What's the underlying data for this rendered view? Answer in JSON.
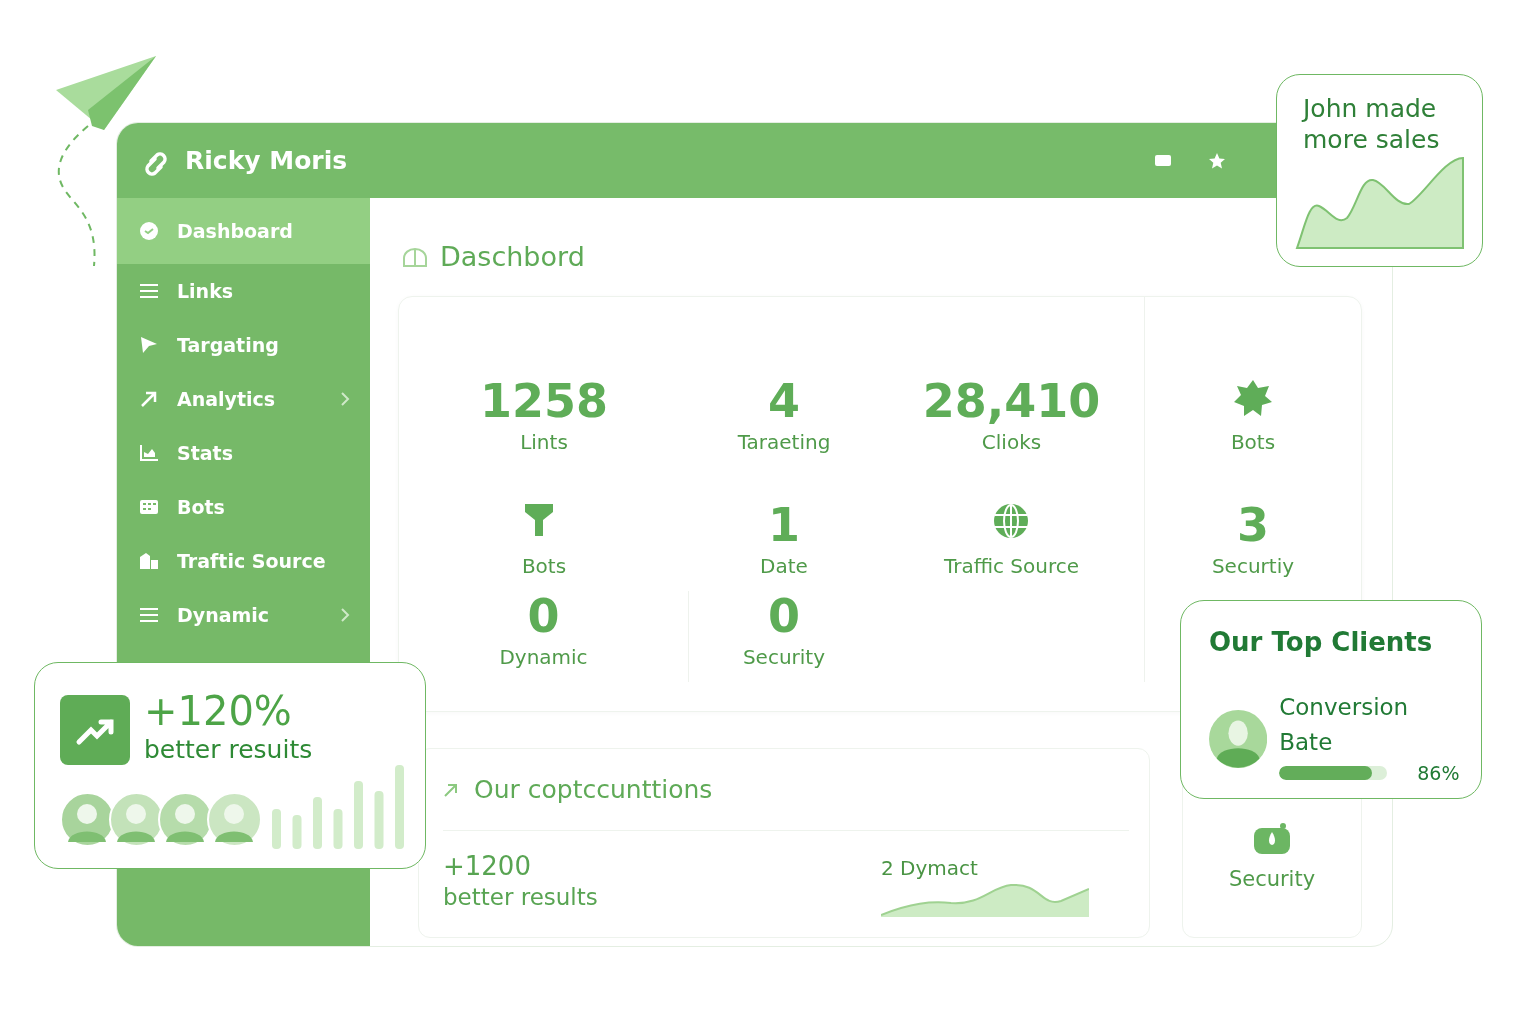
{
  "header": {
    "title": "Ricky Moris"
  },
  "sidebar": {
    "items": [
      {
        "label": "Dashboard",
        "selected": true,
        "expandable": false
      },
      {
        "label": "Links",
        "selected": false,
        "expandable": false
      },
      {
        "label": "Targating",
        "selected": false,
        "expandable": false
      },
      {
        "label": "Analytics",
        "selected": false,
        "expandable": true
      },
      {
        "label": "Stats",
        "selected": false,
        "expandable": false
      },
      {
        "label": "Bots",
        "selected": false,
        "expandable": false
      },
      {
        "label": "Traftic Source",
        "selected": false,
        "expandable": false
      },
      {
        "label": "Dynamic",
        "selected": false,
        "expandable": true
      }
    ]
  },
  "page_title": "Daschbord",
  "stats": [
    {
      "kind": "number",
      "value": "1258",
      "label": "Lints"
    },
    {
      "kind": "number",
      "value": "4",
      "label": "Taraeting"
    },
    {
      "kind": "number",
      "value": "28,410",
      "label": "Clioks"
    },
    {
      "kind": "icon",
      "label": "Bots"
    },
    {
      "kind": "icon",
      "label": "Bots"
    },
    {
      "kind": "number",
      "value": "1",
      "label": "Date"
    },
    {
      "kind": "icon",
      "label": "Traffic Source"
    },
    {
      "kind": "number",
      "value": "3",
      "label": "Securtiy"
    },
    {
      "kind": "number",
      "value": "0",
      "label": "Dynamic"
    },
    {
      "kind": "number",
      "value": "0",
      "label": "Security"
    }
  ],
  "conversions_card": {
    "title": "Our coptccunttions",
    "value": "+1200",
    "caption": "better results",
    "trend_label": "2 Dymact"
  },
  "security_card": {
    "label": "Security"
  },
  "sales_card": {
    "text": "John made more sales"
  },
  "results_card": {
    "value": "+120%",
    "caption": "better resuits"
  },
  "top_clients": {
    "title": "Our Top Clients",
    "clients": [
      {
        "name": "Conversion Bate",
        "level": 0.86,
        "reading": "86%"
      }
    ]
  }
}
